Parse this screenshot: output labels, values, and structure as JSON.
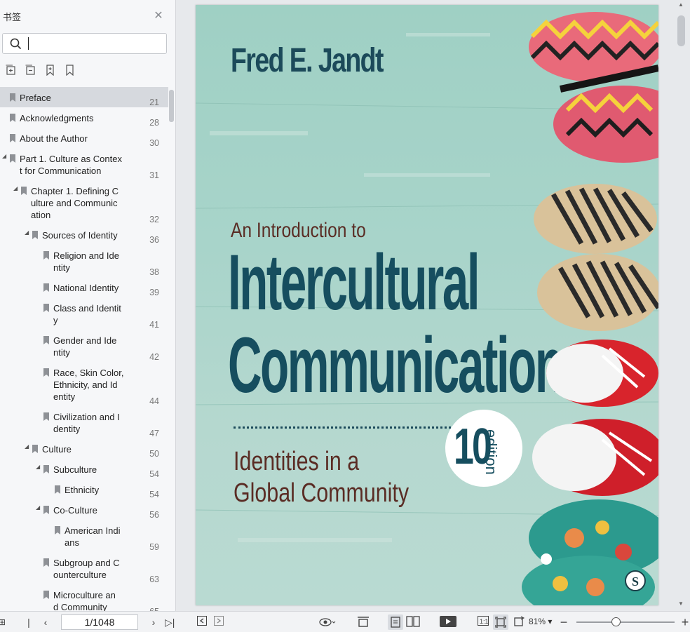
{
  "sidebar": {
    "title": "书签",
    "search": {
      "value": "",
      "placeholder": ""
    },
    "tools": [
      "expand-all-icon",
      "collapse-all-icon",
      "add-bookmark-icon",
      "bookmark-icon"
    ],
    "items": [
      {
        "label": "Preface",
        "page": "21",
        "selected": true,
        "level": 0,
        "toggle": ""
      },
      {
        "label": "Acknowledgments",
        "page": "28",
        "level": 0,
        "toggle": ""
      },
      {
        "label": "About the Author",
        "page": "30",
        "level": 0,
        "toggle": ""
      },
      {
        "label": "Part 1. Culture as Contex\nt for Communication",
        "page": "31",
        "level": 0,
        "toggle": "◢"
      },
      {
        "label": "Chapter 1. Defining C\nulture and Communic\nation",
        "page": "32",
        "level": 1,
        "toggle": "◢"
      },
      {
        "label": "Sources of Identity",
        "page": "36",
        "level": 2,
        "toggle": "◢"
      },
      {
        "label": "Religion and Ide\nntity",
        "page": "38",
        "level": 3,
        "toggle": ""
      },
      {
        "label": "National Identity",
        "page": "39",
        "level": 3,
        "toggle": ""
      },
      {
        "label": "Class and Identit\ny",
        "page": "41",
        "level": 3,
        "toggle": ""
      },
      {
        "label": "Gender and Ide\nntity",
        "page": "42",
        "level": 3,
        "toggle": ""
      },
      {
        "label": "Race, Skin Color,\nEthnicity, and Id\nentity",
        "page": "44",
        "level": 3,
        "toggle": ""
      },
      {
        "label": "Civilization and I\ndentity",
        "page": "47",
        "level": 3,
        "toggle": ""
      },
      {
        "label": "Culture",
        "page": "50",
        "level": 2,
        "toggle": "◢"
      },
      {
        "label": "Subculture",
        "page": "54",
        "level": 3,
        "toggle": "◢"
      },
      {
        "label": "Ethnicity",
        "page": "54",
        "level": 4,
        "toggle": ""
      },
      {
        "label": "Co-Culture",
        "page": "56",
        "level": 3,
        "toggle": "◢"
      },
      {
        "label": "American Indi\nans",
        "page": "59",
        "level": 4,
        "toggle": ""
      },
      {
        "label": "Subgroup and C\nounterculture",
        "page": "63",
        "level": 3,
        "toggle": ""
      },
      {
        "label": "Microculture an\nd Community",
        "page": "65",
        "level": 3,
        "toggle": ""
      }
    ]
  },
  "cover": {
    "author": "Fred E. Jandt",
    "intro": "An Introduction to",
    "title_line1": "Intercultural",
    "title_line2": "Communication",
    "subtitle_line1": "Identities in a",
    "subtitle_line2": "Global Community",
    "edition_number": "10",
    "edition_word": "edition"
  },
  "toolbar": {
    "page_indicator": "1/1048",
    "zoom": "81%",
    "zoom_level_fraction": 0.4
  },
  "colors": {
    "cover_teal": "#164e5f",
    "cover_brown": "#5a2c24",
    "cover_bg": "#a8d4ca"
  }
}
